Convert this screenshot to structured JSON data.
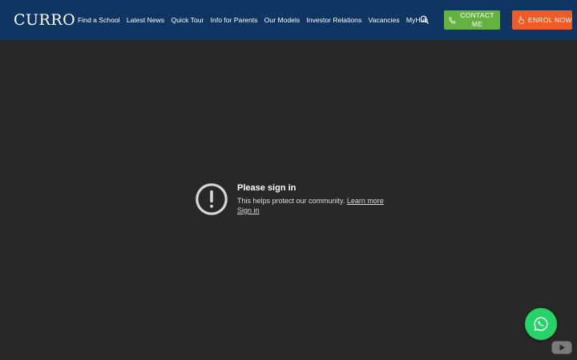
{
  "header": {
    "logo": "CURRO",
    "nav": [
      "Find a School",
      "Latest News",
      "Quick Tour",
      "Info for Parents",
      "Our Models",
      "Investor Relations",
      "Vacancies",
      "MyHub"
    ],
    "contact_label": "CONTACT ME",
    "enrol_label": "ENROL NOW"
  },
  "embed": {
    "title": "Please sign in",
    "message": "This helps protect our community.",
    "learn_more": "Learn more",
    "sign_in": "Sign in"
  },
  "icons": {
    "search": "search-icon",
    "phone": "phone-icon",
    "enrol": "hand-pointer-icon",
    "alert": "exclamation-circle-icon",
    "whatsapp": "whatsapp-icon",
    "youtube": "youtube-icon"
  },
  "colors": {
    "header_bg": "#0f3562",
    "contact_green": "#66b241",
    "enrol_orange": "#ed5b27",
    "whatsapp_green": "#25d366",
    "page_bg": "#282828"
  }
}
